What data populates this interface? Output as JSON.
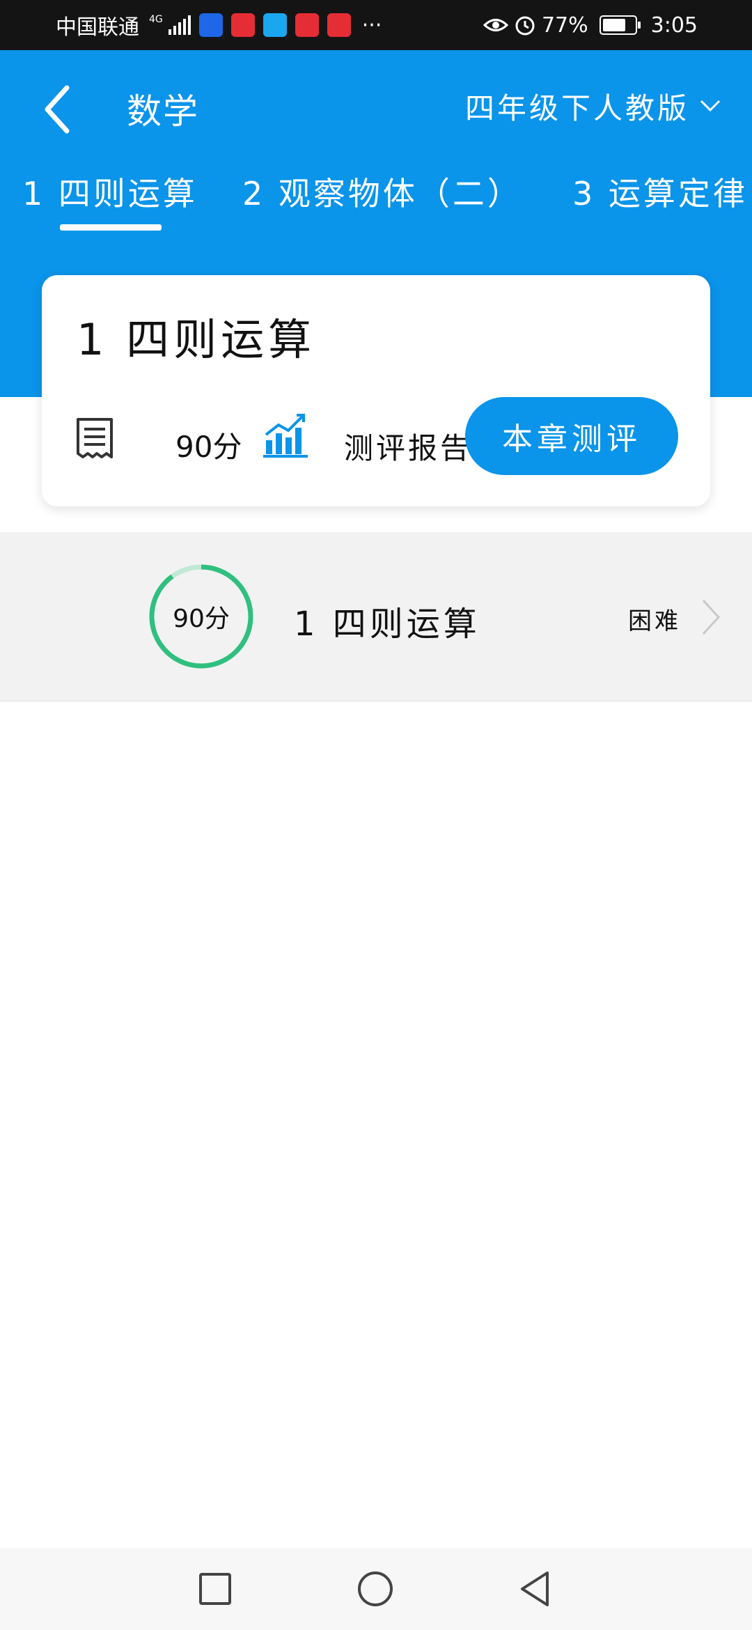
{
  "status_bar": {
    "carrier": "中国联通",
    "network": "4G",
    "more": "···",
    "battery": "77%",
    "battery_level": 0.77,
    "time": "3:05"
  },
  "header": {
    "title": "数学",
    "grade": "四年级下人教版"
  },
  "tabs": [
    {
      "label": "1 四则运算"
    },
    {
      "label": "2 观察物体（二）"
    },
    {
      "label": "3 运算定律"
    }
  ],
  "chapter_card": {
    "title": "1 四则运算",
    "score": "90分",
    "report_label": "测评报告",
    "test_button": "本章测评"
  },
  "sections": [
    {
      "score": "90分",
      "progress": 0.9,
      "title": "1 四则运算",
      "difficulty": "困难"
    }
  ],
  "colors": {
    "primary": "#0a94ea",
    "ring_green": "#2fbf7f",
    "ring_track": "#bfe9d4"
  },
  "icons": {
    "back": "chevron-left-icon",
    "grade_dropdown": "chevron-down-icon",
    "score": "receipt-icon",
    "report": "bar-chart-icon",
    "section_arrow": "chevron-right-icon"
  }
}
